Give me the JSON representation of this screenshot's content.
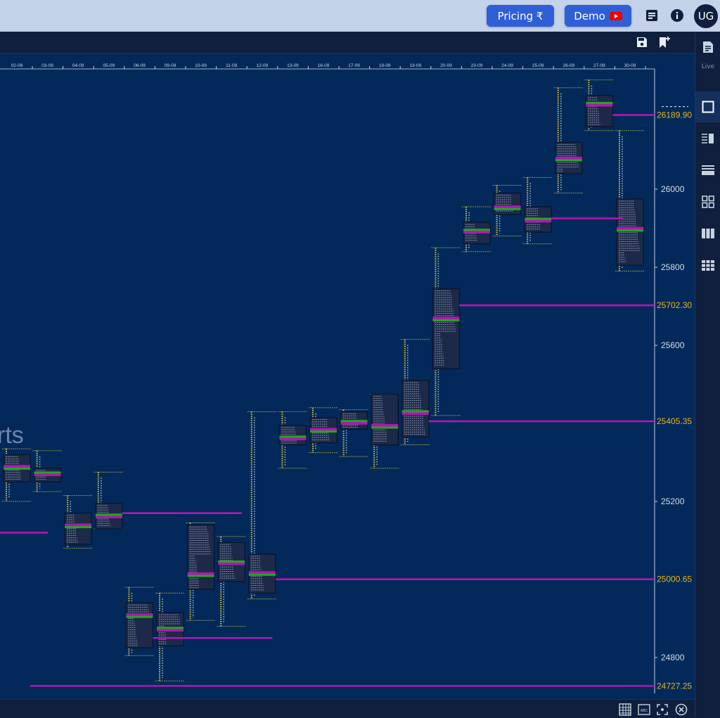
{
  "topbar": {
    "pricing_label": "Pricing ₹",
    "demo_label": "Demo",
    "avatar_initials": "UG"
  },
  "sidebar": {
    "live_label": "Live"
  },
  "watermark": "rts",
  "colors": {
    "plot_bg": "#02295a",
    "poc_line": "#b514b5",
    "value_area_line": "#1faa1f",
    "key_level_label": "#e8b31c",
    "axis_label": "#d5deea",
    "accent_button": "#2f5fd6"
  },
  "chart_data": {
    "type": "market-profile",
    "title": "",
    "xlabel": "",
    "ylabel": "",
    "ylim": [
      24650,
      26480
    ],
    "grid": false,
    "x_tick_labels": [
      "02-09",
      "03-09",
      "04-09",
      "05-09",
      "06-09",
      "09-09",
      "10-09",
      "11-09",
      "12-09",
      "13-09",
      "16-09",
      "17-09",
      "18-09",
      "19-09",
      "20-09",
      "23-09",
      "24-09",
      "25-09",
      "26-09",
      "27-09",
      "30-09"
    ],
    "y_tick_labels": [
      24800,
      25200,
      25600,
      26000,
      25800
    ],
    "key_levels": [
      {
        "label": "26189.90",
        "value": 26189.9,
        "from_session": "27-09"
      },
      {
        "label": "25702.30",
        "value": 25702.3,
        "from_session": "20-09"
      },
      {
        "label": "25405.35",
        "value": 25405.35,
        "from_session": "19-09"
      },
      {
        "label": "25000.65",
        "value": 25000.65,
        "from_session": "12-09"
      },
      {
        "label": "24727.25",
        "value": 24727.25,
        "from_session": "02-09"
      }
    ],
    "other_levels": [
      {
        "value": 25925,
        "from_session": "25-09"
      },
      {
        "value": 25170,
        "from_session": "05-09"
      },
      {
        "value": 25120,
        "from_session": "02-09"
      },
      {
        "value": 24850,
        "from_session": "06-09"
      }
    ],
    "sessions": [
      {
        "date": "02-09",
        "high": 25335,
        "low": 25200,
        "vah": 25320,
        "val": 25250,
        "poc": 25290
      },
      {
        "date": "03-09",
        "high": 25330,
        "low": 25225,
        "vah": 25285,
        "val": 25250,
        "poc": 25268
      },
      {
        "date": "04-09",
        "high": 25215,
        "low": 25080,
        "vah": 25170,
        "val": 25090,
        "poc": 25140
      },
      {
        "date": "05-09",
        "high": 25275,
        "low": 25130,
        "vah": 25195,
        "val": 25130,
        "poc": 25160
      },
      {
        "date": "06-09",
        "high": 24980,
        "low": 24805,
        "vah": 24940,
        "val": 24825,
        "poc": 24910
      },
      {
        "date": "09-09",
        "high": 24965,
        "low": 24740,
        "vah": 24915,
        "val": 24830,
        "poc": 24870
      },
      {
        "date": "10-09",
        "high": 25145,
        "low": 24895,
        "vah": 25140,
        "val": 24975,
        "poc": 25015
      },
      {
        "date": "11-09",
        "high": 25110,
        "low": 24880,
        "vah": 25095,
        "val": 24995,
        "poc": 25040
      },
      {
        "date": "12-09",
        "high": 25430,
        "low": 24950,
        "vah": 25065,
        "val": 24965,
        "poc": 25018
      },
      {
        "date": "13-09",
        "high": 25430,
        "low": 25285,
        "vah": 25395,
        "val": 25345,
        "poc": 25360
      },
      {
        "date": "16-09",
        "high": 25440,
        "low": 25325,
        "vah": 25415,
        "val": 25350,
        "poc": 25385
      },
      {
        "date": "17-09",
        "high": 25435,
        "low": 25315,
        "vah": 25430,
        "val": 25385,
        "poc": 25400
      },
      {
        "date": "18-09",
        "high": 25475,
        "low": 25285,
        "vah": 25475,
        "val": 25345,
        "poc": 25395
      },
      {
        "date": "19-09",
        "high": 25615,
        "low": 25345,
        "vah": 25510,
        "val": 25365,
        "poc": 25425
      },
      {
        "date": "20-09",
        "high": 25850,
        "low": 25420,
        "vah": 25745,
        "val": 25540,
        "poc": 25670
      },
      {
        "date": "23-09",
        "high": 25955,
        "low": 25840,
        "vah": 25915,
        "val": 25860,
        "poc": 25890
      },
      {
        "date": "24-09",
        "high": 26010,
        "low": 25880,
        "vah": 25990,
        "val": 25935,
        "poc": 25955
      },
      {
        "date": "25-09",
        "high": 26030,
        "low": 25860,
        "vah": 25955,
        "val": 25890,
        "poc": 25918
      },
      {
        "date": "26-09",
        "high": 26260,
        "low": 25990,
        "vah": 26120,
        "val": 26040,
        "poc": 26080
      },
      {
        "date": "27-09",
        "high": 26280,
        "low": 26150,
        "vah": 26240,
        "val": 26160,
        "poc": 26215
      },
      {
        "date": "30-09",
        "high": 26150,
        "low": 25790,
        "vah": 25975,
        "val": 25805,
        "poc": 25900
      }
    ]
  }
}
